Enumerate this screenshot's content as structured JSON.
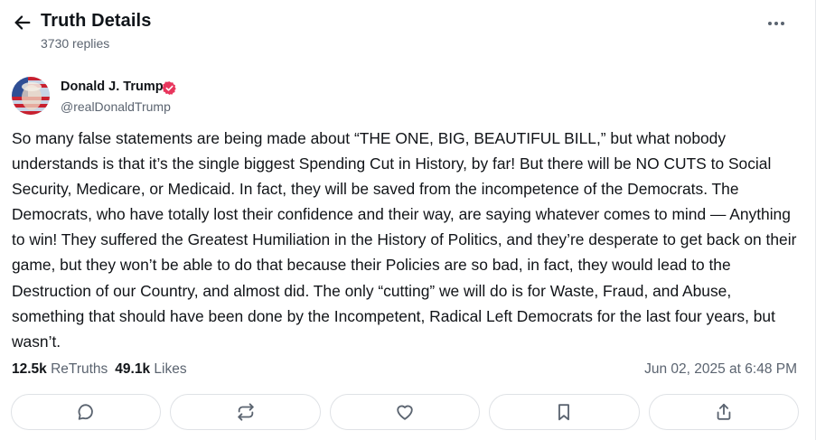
{
  "header": {
    "title": "Truth Details",
    "replies": "3730 replies",
    "back_icon": "arrow-left-icon",
    "more_icon": "ellipsis-icon"
  },
  "author": {
    "name": "Donald J. Trump",
    "handle": "@realDonaldTrump",
    "verified": true,
    "verified_color": "#e8365d"
  },
  "post": {
    "text": "So many false statements are being made about “THE ONE, BIG, BEAUTIFUL BILL,” but what nobody understands is that it’s the single biggest Spending Cut in History, by far! But there will be NO CUTS to Social Security, Medicare, or Medicaid. In fact, they will be saved from the incompetence of the Democrats. The Democrats, who have totally lost their confidence and their way, are saying whatever comes to mind — Anything to win! They suffered the Greatest Humiliation in the History of Politics, and they’re desperate to get back on their game, but they won’t be able to do that because their Policies are so bad, in fact, they would lead to the Destruction of our Country, and almost did. The only “cutting” we will do is for Waste, Fraud, and Abuse, something that should have been done by the Incompetent, Radical Left Democrats for the last four years, but wasn’t.",
    "retruths_count": "12.5k",
    "retruths_label": "ReTruths",
    "likes_count": "49.1k",
    "likes_label": "Likes",
    "timestamp": "Jun 02, 2025 at 6:48 PM"
  },
  "actions": [
    {
      "name": "reply",
      "icon": "comment-icon"
    },
    {
      "name": "retruth",
      "icon": "repost-icon"
    },
    {
      "name": "like",
      "icon": "heart-icon"
    },
    {
      "name": "bookmark",
      "icon": "bookmark-icon"
    },
    {
      "name": "share",
      "icon": "share-icon"
    }
  ],
  "colors": {
    "text": "#111418",
    "muted": "#5b6470",
    "border": "#dfe2e6",
    "icon": "#5b6470"
  }
}
